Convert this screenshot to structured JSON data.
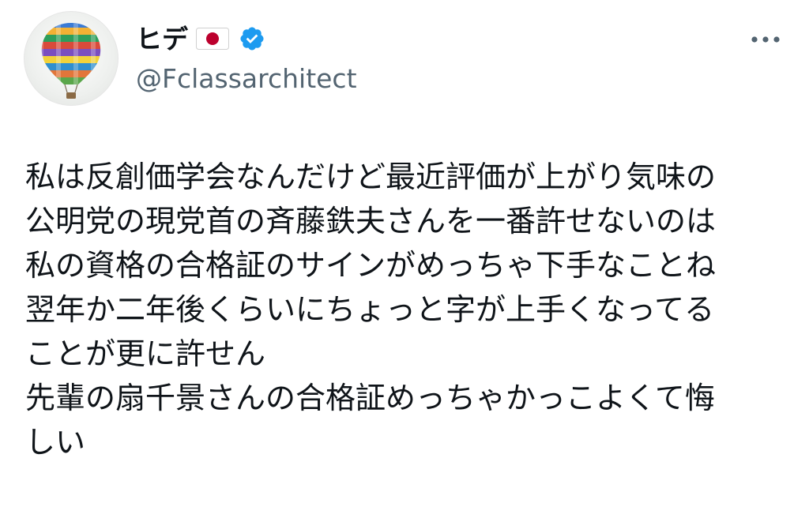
{
  "author": {
    "display_name": "ヒデ",
    "flag_icon": "japan-flag-icon",
    "verified_icon": "verified-badge-icon",
    "verified_color": "#1d9bf0",
    "handle": "@Fclassarchitect",
    "avatar_icon": "hot-air-balloon-avatar"
  },
  "menu": {
    "more_icon": "more-options-icon"
  },
  "tweet": {
    "lines": [
      "私は反創価学会なんだけど最近評価が上がり気味の",
      "公明党の現党首の斉藤鉄夫さんを一番許せないのは",
      "私の資格の合格証のサインがめっちゃ下手なことね",
      "翌年か二年後くらいにちょっと字が上手くなってる",
      "ことが更に許せん",
      "先輩の扇千景さんの合格証めっちゃかっこよくて悔",
      "しい"
    ]
  },
  "colors": {
    "text": "#0f1419",
    "secondary": "#536471",
    "accent": "#1d9bf0"
  }
}
